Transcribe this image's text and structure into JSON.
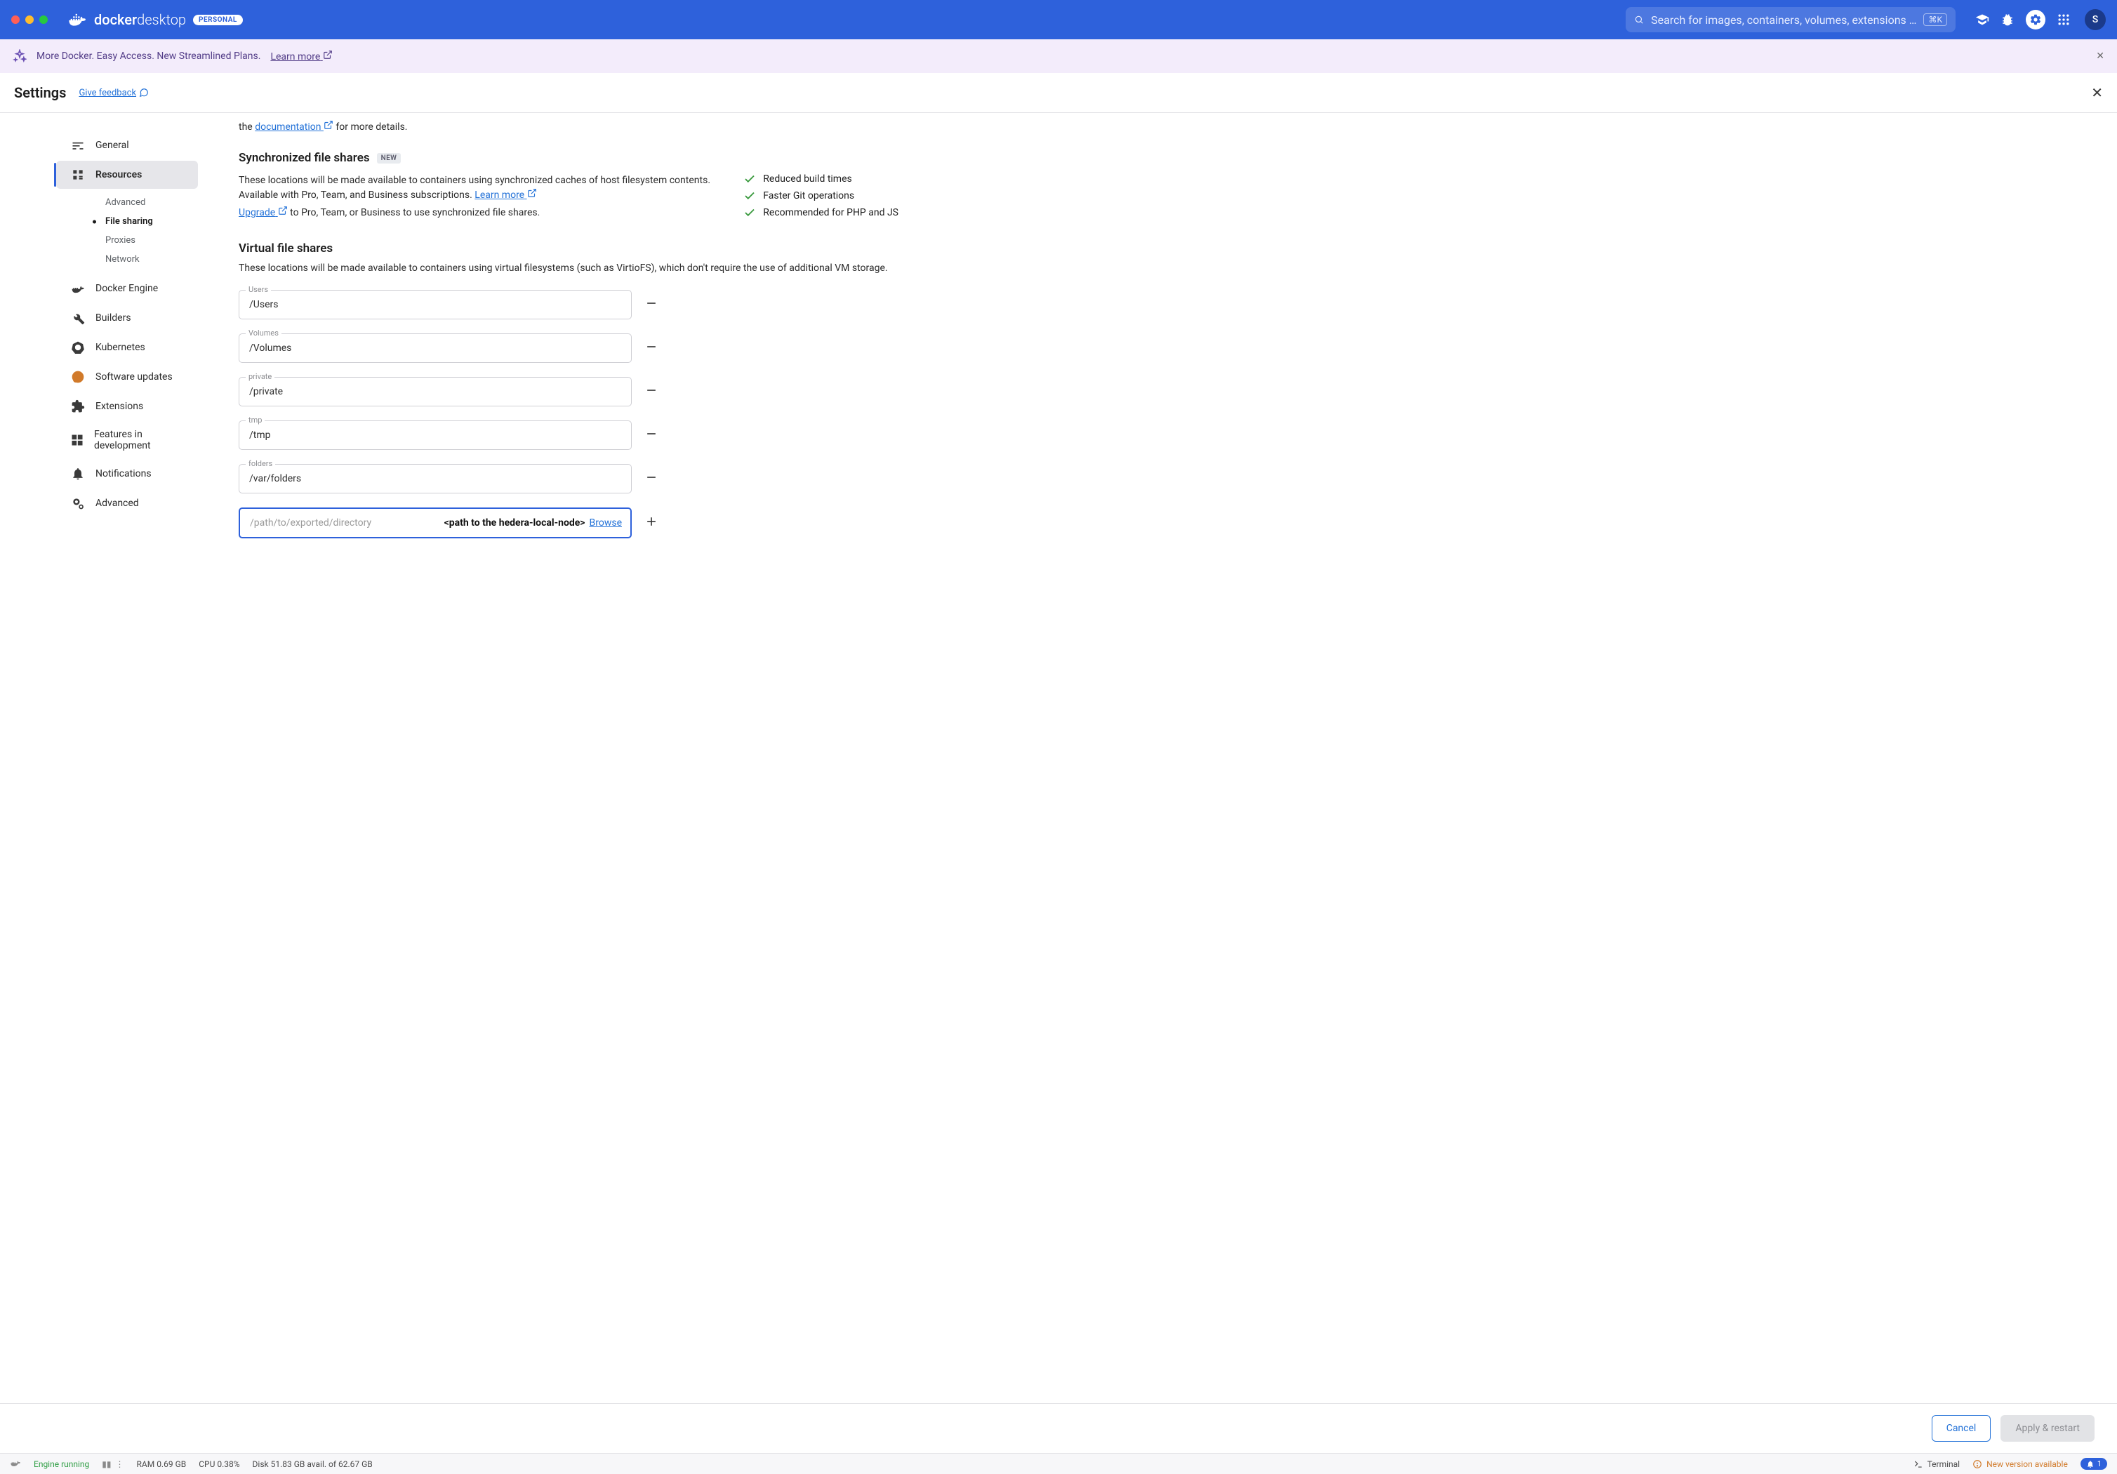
{
  "titlebar": {
    "brand_bold": "docker",
    "brand_light": "desktop",
    "edition": "PERSONAL",
    "search_placeholder": "Search for images, containers, volumes, extensions …",
    "search_shortcut": "⌘K",
    "avatar": "S"
  },
  "banner": {
    "text": "More Docker. Easy Access. New Streamlined Plans.",
    "link": "Learn more"
  },
  "page": {
    "title": "Settings",
    "feedback": "Give feedback"
  },
  "sidebar": {
    "items": {
      "general": "General",
      "resources": "Resources",
      "docker_engine": "Docker Engine",
      "builders": "Builders",
      "kubernetes": "Kubernetes",
      "software_updates": "Software updates",
      "extensions": "Extensions",
      "features": "Features in development",
      "notifications": "Notifications",
      "advanced": "Advanced"
    },
    "subitems": {
      "advanced_sub": "Advanced",
      "file_sharing": "File sharing",
      "proxies": "Proxies",
      "network": "Network"
    }
  },
  "content": {
    "partial_prefix": "the ",
    "partial_link": "documentation",
    "partial_suffix": " for more details.",
    "sync_title": "Synchronized file shares",
    "new_tag": "NEW",
    "sync_desc_1": "These locations will be made available to containers using synchronized caches of host filesystem contents. Available with Pro, Team, and Business subscriptions. ",
    "learn_more": "Learn more",
    "benefits": [
      "Reduced build times",
      "Faster Git operations",
      "Recommended for PHP and JS"
    ],
    "upgrade_link": "Upgrade",
    "upgrade_suffix": " to Pro, Team, or Business to use synchronized file shares.",
    "virtual_title": "Virtual file shares",
    "virtual_desc": "These locations will be made available to containers using virtual filesystems (such as VirtioFS), which don't require the use of additional VM storage.",
    "shares": [
      {
        "label": "Users",
        "value": "/Users"
      },
      {
        "label": "Volumes",
        "value": "/Volumes"
      },
      {
        "label": "private",
        "value": "/private"
      },
      {
        "label": "tmp",
        "value": "/tmp"
      },
      {
        "label": "folders",
        "value": "/var/folders"
      }
    ],
    "add_placeholder": "/path/to/exported/directory",
    "add_hint": "<path to the hedera-local-node>",
    "browse": "Browse"
  },
  "actions": {
    "cancel": "Cancel",
    "apply": "Apply & restart"
  },
  "status": {
    "engine": "Engine running",
    "ram": "RAM 0.69 GB",
    "cpu": "CPU 0.38%",
    "disk": "Disk 51.83 GB avail. of 62.67 GB",
    "terminal": "Terminal",
    "update": "New version available",
    "notif_count": "1"
  }
}
